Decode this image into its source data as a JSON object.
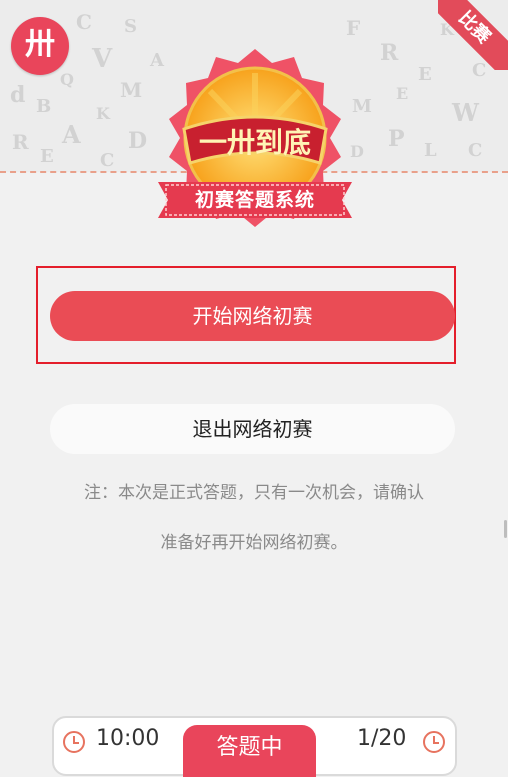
{
  "header": {
    "logo_text": "卅",
    "corner_label": "比赛",
    "badge_text": "一卅到底",
    "system_title": "初赛答题系统"
  },
  "actions": {
    "start_label": "开始网络初赛",
    "exit_label": "退出网络初赛"
  },
  "note": {
    "line1": "注：本次是正式答题，只有一次机会，请确认",
    "line2": "准备好再开始网络初赛。"
  },
  "footer": {
    "timer": "10:00",
    "status": "答题中",
    "progress": "1/20"
  },
  "colors": {
    "accent": "#ea4c55",
    "highlight_border": "#e41e2b",
    "background": "#f1f1f1"
  },
  "icons": [
    "app-logo-icon",
    "clock-icon",
    "trophy-badge-icon"
  ]
}
